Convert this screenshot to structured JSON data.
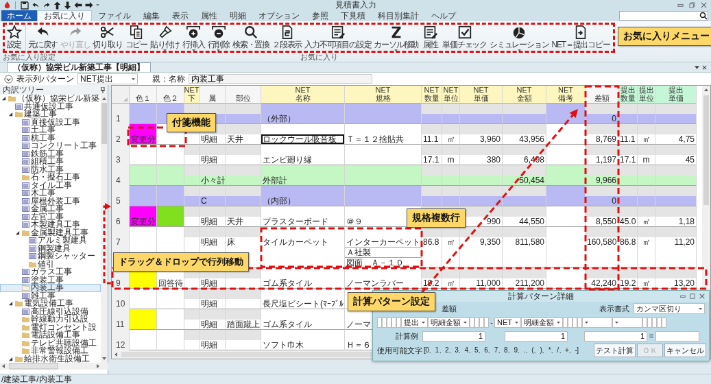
{
  "window": {
    "title": "見積書入力"
  },
  "tabs": [
    {
      "label": "ホーム",
      "kind": "app",
      "selected": false
    },
    {
      "label": "お気に入り",
      "kind": "tab",
      "selected": true
    },
    {
      "label": "ファイル",
      "kind": "tab",
      "selected": false
    },
    {
      "label": "編集",
      "kind": "tab",
      "selected": false
    },
    {
      "label": "表示",
      "kind": "tab",
      "selected": false
    },
    {
      "label": "属性",
      "kind": "tab",
      "selected": false
    },
    {
      "label": "明細",
      "kind": "tab",
      "selected": false
    },
    {
      "label": "オプション",
      "kind": "tab",
      "selected": false
    },
    {
      "label": "参照",
      "kind": "tab",
      "selected": false
    },
    {
      "label": "下見積",
      "kind": "tab",
      "selected": false
    },
    {
      "label": "科目別集計",
      "kind": "tab",
      "selected": false
    },
    {
      "label": "ヘルプ",
      "kind": "tab",
      "selected": false
    }
  ],
  "ribbon": {
    "groups": [
      {
        "label": "お気に入り設定",
        "buttons": [
          {
            "label": "設定",
            "disabled": false,
            "has_menu": false
          }
        ]
      },
      {
        "label": "お気に入り",
        "buttons": [
          {
            "label": "元に戻す",
            "disabled": false,
            "has_menu": false
          },
          {
            "label": "やり直し",
            "disabled": true,
            "has_menu": false
          },
          {
            "label": "切り取り",
            "disabled": false,
            "has_menu": false
          },
          {
            "label": "コピー",
            "disabled": false,
            "has_menu": false
          },
          {
            "label": "貼り付け",
            "disabled": false,
            "has_menu": true
          },
          {
            "label": "行挿入",
            "disabled": false,
            "has_menu": true
          },
          {
            "label": "行削除",
            "disabled": false,
            "has_menu": true
          },
          {
            "label": "検索・置換",
            "disabled": false,
            "has_menu": false
          },
          {
            "label": "２段表示",
            "disabled": false,
            "has_menu": false
          },
          {
            "label": "入力不可項目の設定",
            "disabled": false,
            "has_menu": false
          },
          {
            "label": "カーソル移動",
            "disabled": false,
            "has_menu": true
          },
          {
            "label": "属性",
            "disabled": false,
            "has_menu": false
          },
          {
            "label": "単価チェック",
            "disabled": false,
            "has_menu": false
          },
          {
            "label": "シミュレーション",
            "disabled": false,
            "has_menu": true
          },
          {
            "label": "NET＝提出コピー",
            "disabled": false,
            "has_menu": false
          }
        ]
      }
    ]
  },
  "document_tab": {
    "title": "（仮称）協栄ビル新築工事【明細】"
  },
  "filter": {
    "pattern_label": "表示列パターン",
    "pattern_value": "NET提出",
    "parent_label": "親：名称",
    "parent_value": "内装工事"
  },
  "tree": {
    "title": "内訳ツリー",
    "items": [
      {
        "label": "（仮称）協栄ビル新築",
        "kind": "folder",
        "selected": false,
        "expanded": true,
        "children": [
          {
            "label": "共通仮設工事",
            "kind": "sheet",
            "selected": false
          },
          {
            "label": "建築工事",
            "kind": "folder",
            "selected": false,
            "expanded": true,
            "children": [
              {
                "label": "直接仮設工事",
                "kind": "sheet",
                "selected": false
              },
              {
                "label": "土工事",
                "kind": "sheet",
                "selected": false
              },
              {
                "label": "杭工事",
                "kind": "sheet",
                "selected": false
              },
              {
                "label": "コンクリート工事",
                "kind": "sheet",
                "selected": false
              },
              {
                "label": "鉄筋工事",
                "kind": "sheet",
                "selected": false
              },
              {
                "label": "組積工事",
                "kind": "sheet",
                "selected": false
              },
              {
                "label": "防水工事",
                "kind": "sheet",
                "selected": false
              },
              {
                "label": "石・擬石工事",
                "kind": "folder",
                "selected": false
              },
              {
                "label": "タイル工事",
                "kind": "sheet",
                "selected": false
              },
              {
                "label": "木工事",
                "kind": "sheet",
                "selected": false
              },
              {
                "label": "屋根外装工事",
                "kind": "sheet",
                "selected": false
              },
              {
                "label": "金属工事",
                "kind": "sheet",
                "selected": false
              },
              {
                "label": "左官工事",
                "kind": "sheet",
                "selected": false
              },
              {
                "label": "木製建具工事",
                "kind": "sheet",
                "selected": false
              },
              {
                "label": "金属製建具工事",
                "kind": "folder",
                "selected": false,
                "expanded": true,
                "children": [
                  {
                    "label": "アルミ製建具",
                    "kind": "sheet",
                    "selected": false
                  },
                  {
                    "label": "鋼製建具",
                    "kind": "sheet",
                    "selected": false
                  },
                  {
                    "label": "鋼製シャッター",
                    "kind": "sheet",
                    "selected": false
                  },
                  {
                    "label": "値引",
                    "kind": "folder",
                    "selected": false
                  }
                ]
              },
              {
                "label": "ガラス工事",
                "kind": "sheet",
                "selected": false
              },
              {
                "label": "塗装工事",
                "kind": "sheet",
                "selected": false
              },
              {
                "label": "内装工事",
                "kind": "folder",
                "selected": true
              },
              {
                "label": "雑工事",
                "kind": "sheet",
                "selected": false
              }
            ]
          },
          {
            "label": "電気設備工事",
            "kind": "folder",
            "selected": false,
            "expanded": true,
            "children": [
              {
                "label": "高圧線引込設備",
                "kind": "sheet",
                "selected": false
              },
              {
                "label": "幹線動力引込設",
                "kind": "folder",
                "selected": false
              },
              {
                "label": "電灯コンセント設",
                "kind": "folder",
                "selected": false
              },
              {
                "label": "電話設備工事",
                "kind": "folder",
                "selected": false
              },
              {
                "label": "テレビ共聴設備工",
                "kind": "folder",
                "selected": false
              },
              {
                "label": "非常警報設備工",
                "kind": "folder",
                "selected": false
              }
            ]
          },
          {
            "label": "給排水衛生設備工",
            "kind": "folder",
            "selected": false,
            "expanded": true
          }
        ]
      }
    ]
  },
  "grid": {
    "columns": [
      {
        "label": "色１"
      },
      {
        "label": "色２"
      },
      {
        "group": "NET",
        "label": "下",
        "color": "#fdf6bf"
      },
      {
        "label": "属"
      },
      {
        "label": "部位"
      },
      {
        "group": "NET",
        "label": "名称",
        "color": "#fdf6bf"
      },
      {
        "group": "NET",
        "label": "規格",
        "color": "#fdf6bf"
      },
      {
        "group": "NET",
        "label": "数量",
        "color": "#fdf6bf"
      },
      {
        "group": "NET",
        "label": "単位",
        "color": "#fdf6bf"
      },
      {
        "group": "NET",
        "label": "単価",
        "color": "#fdf6bf"
      },
      {
        "group": "NET",
        "label": "金額",
        "color": "#fdf6bf"
      },
      {
        "group": "NET",
        "label": "備考",
        "color": "#fdf6bf"
      },
      {
        "label": "差額"
      },
      {
        "group": "提出",
        "label": "数量",
        "color": "#c6f6d8"
      },
      {
        "group": "提出",
        "label": "単位",
        "color": "#c6f6d8"
      },
      {
        "group": "提出",
        "label": "単価",
        "color": "#c6f6d8"
      }
    ],
    "rows": [
      {
        "num": "1",
        "kind": "section",
        "focused": false,
        "name": "（外部）",
        "diff": "0"
      },
      {
        "num": "2",
        "kind": "detail",
        "focused": true,
        "tag1": {
          "color": "#ff00ff",
          "text": "変更分"
        },
        "attr": "明細",
        "part": "天井",
        "name": "ロックウール吸音板",
        "spec": [
          "Ｔ＝１２捨貼共"
        ],
        "qty": "11.1",
        "unit": "㎡",
        "price": "3,960",
        "amount": "43,956",
        "diff": "8,769",
        "sub_qty": "11.1",
        "sub_unit": "㎡",
        "sub_price": "4,75"
      },
      {
        "num": "3",
        "kind": "detail",
        "focused": false,
        "attr": "明細",
        "name": "エンビ廻り縁",
        "qty": "17.1",
        "unit": "m",
        "price": "380",
        "amount": "6,498",
        "diff": "1,197",
        "sub_qty": "17.1",
        "sub_unit": "m",
        "sub_price": "45"
      },
      {
        "num": "4",
        "kind": "subtotal",
        "focused": false,
        "attr": "小々計",
        "name": "外部計",
        "amount": "50,454",
        "diff": "9,966"
      },
      {
        "num": "5",
        "kind": "section",
        "focused": false,
        "attr": "C",
        "name": "（内部）",
        "diff": "0"
      },
      {
        "num": "6",
        "kind": "detail",
        "focused": false,
        "tag1": {
          "color": "#ff00ff",
          "text": "変更分"
        },
        "tag2": {
          "color": "#80e020"
        },
        "attr": "明細",
        "part": "天井",
        "name": "プラスターボード",
        "spec": [
          "＠９"
        ],
        "price": "990",
        "amount": "44,550",
        "diff": "8,550",
        "sub_qty": "45.0",
        "sub_unit": "㎡",
        "sub_price": "1,18"
      },
      {
        "num": "7",
        "kind": "detail",
        "focused": false,
        "attr": "明細",
        "part": "床",
        "name": "タイルカーペット",
        "spec": [
          "インターカーペット",
          "Ａ社製",
          "図面　Ａ－１０"
        ],
        "qty": "86.8",
        "unit": "㎡",
        "price": "9,350",
        "amount": "811,580",
        "diff": "160,580",
        "sub_qty": "86.8",
        "sub_unit": "㎡",
        "sub_price": "11,20"
      },
      {
        "num": "9",
        "kind": "detail",
        "focused": false,
        "tag1": {
          "color": "#ffff00"
        },
        "tag2": {
          "text": "回答待"
        },
        "attr": "明細",
        "name": "ゴム系タイル",
        "spec": [
          "ノーマンラバー"
        ],
        "qty": "19.2",
        "unit": "㎡",
        "price": "11,000",
        "amount": "211,200",
        "diff": "42,240",
        "sub_qty": "19.2",
        "sub_unit": "㎡",
        "sub_price": "13,20"
      },
      {
        "num": "10",
        "kind": "detail",
        "focused": false,
        "attr": "明細",
        "name": "長尺塩ビシート(ﾏｰﾌﾞﾙ"
      },
      {
        "num": "11",
        "kind": "detail",
        "focused": false,
        "tag1": {
          "color": "#ffff00"
        },
        "attr": "明細",
        "part": "踏面蹴上",
        "name": "ゴム系タイル",
        "spec": [
          "ノーマ"
        ]
      },
      {
        "num": "12",
        "kind": "detail",
        "focused": false,
        "attr": "明細",
        "name": "ソフト巾木",
        "spec": [
          "Ｈ＝６"
        ]
      }
    ]
  },
  "dialog": {
    "title": "計算パターン詳細",
    "name": "差額",
    "format_label": "表示書式",
    "format_value": "カンマ区切り",
    "formula": [
      {
        "kind": "box"
      },
      {
        "kind": "box"
      },
      {
        "kind": "box"
      },
      {
        "kind": "box"
      },
      {
        "kind": "box"
      },
      {
        "kind": "select",
        "value": "提出"
      },
      {
        "kind": "select",
        "value": "明細金額"
      },
      {
        "kind": "box"
      },
      {
        "kind": "box"
      },
      {
        "kind": "box"
      },
      {
        "kind": "box"
      },
      {
        "kind": "operator",
        "text": "-"
      },
      {
        "kind": "select",
        "value": "NET"
      },
      {
        "kind": "select",
        "value": "明細金額"
      },
      {
        "kind": "box"
      },
      {
        "kind": "box"
      },
      {
        "kind": "box"
      },
      {
        "kind": "box"
      },
      {
        "kind": "select"
      },
      {
        "kind": "select"
      },
      {
        "kind": "box"
      },
      {
        "kind": "box"
      },
      {
        "kind": "box"
      },
      {
        "kind": "box"
      },
      {
        "kind": "box"
      }
    ],
    "example_label": "計算例",
    "examples": [
      "1",
      "1",
      "1"
    ],
    "equals": "=",
    "allowed_label": "使用可能文字",
    "allowed": "[0、1、2、3、4、5、6、7、8、9、.、(、)、*、/、+、-]",
    "buttons": [
      {
        "label": "テスト計算",
        "disabled": false
      },
      {
        "label": "ＯＫ",
        "disabled": true
      },
      {
        "label": "キャンセル",
        "disabled": false
      }
    ]
  },
  "callouts": [
    {
      "text": "お気に入りメニュー"
    },
    {
      "text": "付箋機能"
    },
    {
      "text": "規格複数行"
    },
    {
      "text": "ドラッグ＆ドロップで行列移動"
    },
    {
      "text": "計算パターン設定"
    }
  ],
  "status_bar": {
    "path": "/建築工事/内装工事"
  }
}
